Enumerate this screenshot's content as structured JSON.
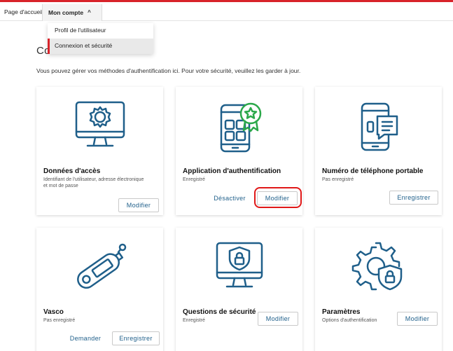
{
  "nav": {
    "home": "Page d'accueil",
    "account": "Mon compte",
    "account_chevron": "^"
  },
  "dropdown": {
    "items": [
      {
        "label": "Profil de l'utilisateur",
        "active": false
      },
      {
        "label": "Connexion et sécurité",
        "active": true
      }
    ]
  },
  "page": {
    "title": "Connexion et sécurité",
    "intro": "Vous pouvez gérer vos méthodes d'authentification ici. Pour votre sécurité, veuillez les garder à jour."
  },
  "cards": [
    {
      "title": "Données d'accès",
      "subtitle": "Identifiant de l'utilisateur, adresse électronique et mot de passe",
      "icon": "monitor-gear-icon",
      "buttons": [
        "Modifier"
      ]
    },
    {
      "title": "Application d'authentification",
      "subtitle": "Enregistré",
      "icon": "phone-app-badge-icon",
      "buttons": [
        "Désactiver",
        "Modifier"
      ]
    },
    {
      "title": "Numéro de téléphone portable",
      "subtitle": "Pas enregistré",
      "icon": "phone-sms-icon",
      "buttons": [
        "Enregistrer"
      ]
    },
    {
      "title": "Vasco",
      "subtitle": "Pas enregistré",
      "icon": "token-device-icon",
      "buttons": [
        "Demander",
        "Enregistrer"
      ]
    },
    {
      "title": "Questions de sécurité",
      "subtitle": "Enregistré",
      "icon": "monitor-shield-lock-icon",
      "buttons": [
        "Modifier"
      ]
    },
    {
      "title": "Paramètres",
      "subtitle": "Options d'authentification",
      "icon": "gear-shield-lock-icon",
      "buttons": [
        "Modifier"
      ]
    }
  ],
  "colors": {
    "accent_red": "#d8232a",
    "icon_blue": "#1f5f8a",
    "badge_green": "#2ba84a",
    "highlight_red": "#e01818"
  }
}
